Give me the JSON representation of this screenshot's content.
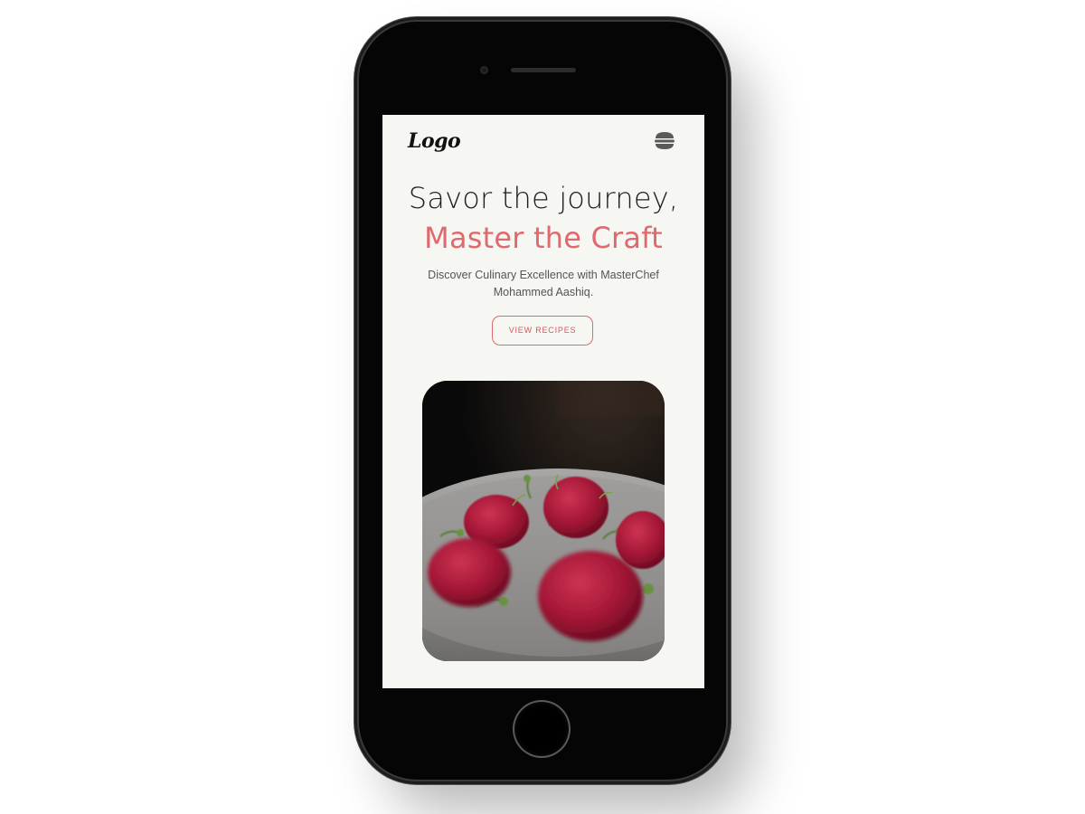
{
  "header": {
    "logo_text": "Logo",
    "menu_icon": "hamburger-menu-icon"
  },
  "hero": {
    "title_line1": "Savor the journey,",
    "title_line2": "Master the Craft",
    "subtitle": "Discover Culinary Excellence with MasterChef Mohammed Aashiq.",
    "cta_label": "VIEW RECIPES"
  },
  "colors": {
    "accent": "#e0696d",
    "background": "#f6f6f2",
    "text": "#1f1f1f"
  }
}
